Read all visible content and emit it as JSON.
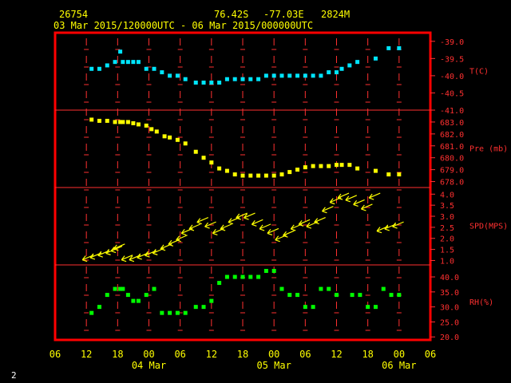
{
  "header": {
    "station": "26754",
    "lat": "76.42S",
    "lon": "-77.03E",
    "elev": "2824M",
    "range": "03 Mar 2015/120000UTC - 06 Mar 2015/000000UTC"
  },
  "footer": {
    "page": "2"
  },
  "colors": {
    "frame": "#ff0000",
    "grid": "#ff3030",
    "temp": "#00e5ff",
    "pres": "#ffff00",
    "wind": "#ffff00",
    "rh": "#00ff00",
    "text": "#ffff00"
  },
  "x_axis": {
    "start_hour": 6,
    "end_hour": 78,
    "tick_labels": [
      "06",
      "12",
      "18",
      "00",
      "06",
      "12",
      "18",
      "00",
      "06",
      "12",
      "18",
      "00",
      "06"
    ],
    "date_labels": [
      {
        "hour": 24,
        "text": "04 Mar"
      },
      {
        "hour": 48,
        "text": "05 Mar"
      },
      {
        "hour": 72,
        "text": "06 Mar"
      }
    ]
  },
  "chart_data": [
    {
      "type": "scatter",
      "unit_label": "T(C)",
      "ylim": [
        -41.0,
        -38.75
      ],
      "ticks": [
        "-39.0",
        "-39.5",
        "-40.0",
        "-40.5",
        "-41.0"
      ],
      "x": [
        13,
        14.5,
        16,
        17.5,
        18.5,
        19,
        20,
        21,
        22,
        23.5,
        25,
        26.5,
        28,
        29.5,
        31,
        33,
        34.5,
        36,
        37.5,
        39,
        40.5,
        42,
        43.5,
        45,
        46.5,
        48,
        49.5,
        51,
        52.5,
        54,
        55.5,
        57,
        58.5,
        60,
        61,
        62.5,
        64,
        67.5,
        70,
        72
      ],
      "values": [
        -39.8,
        -39.8,
        -39.7,
        -39.6,
        -39.3,
        -39.6,
        -39.6,
        -39.6,
        -39.6,
        -39.8,
        -39.8,
        -39.9,
        -40.0,
        -40.0,
        -40.1,
        -40.2,
        -40.2,
        -40.2,
        -40.2,
        -40.1,
        -40.1,
        -40.1,
        -40.1,
        -40.1,
        -40.0,
        -40.0,
        -40.0,
        -40.0,
        -40.0,
        -40.0,
        -40.0,
        -40.0,
        -39.9,
        -39.9,
        -39.8,
        -39.7,
        -39.6,
        -39.5,
        -39.2,
        -39.2
      ]
    },
    {
      "type": "scatter",
      "unit_label": "Pre (mb)",
      "ylim": [
        677.5,
        684.0
      ],
      "ticks": [
        "683.0",
        "682.0",
        "681.0",
        "680.0",
        "679.0",
        "678.0"
      ],
      "x": [
        13,
        14.5,
        16,
        17.5,
        18.5,
        19,
        20,
        21,
        22,
        23.5,
        24.5,
        25.5,
        27,
        28,
        29.5,
        31,
        33,
        34.5,
        36,
        37.5,
        39,
        40.5,
        42,
        43.5,
        45,
        46.5,
        48,
        49.5,
        51,
        52.5,
        54,
        55.5,
        57,
        58.5,
        60,
        61,
        62.5,
        64,
        67.5,
        70,
        72
      ],
      "values": [
        683.2,
        683.1,
        683.1,
        683.0,
        683.0,
        683.0,
        683.0,
        682.9,
        682.8,
        682.7,
        682.4,
        682.2,
        681.8,
        681.7,
        681.5,
        681.2,
        680.5,
        680.0,
        679.6,
        679.1,
        678.9,
        678.6,
        678.5,
        678.5,
        678.5,
        678.5,
        678.5,
        678.6,
        678.8,
        679.0,
        679.2,
        679.3,
        679.3,
        679.3,
        679.4,
        679.4,
        679.4,
        679.1,
        678.9,
        678.6,
        678.6
      ]
    },
    {
      "type": "scatter",
      "unit_label": "SPD(MPS)",
      "ylim": [
        0.8,
        4.3
      ],
      "ticks": [
        "4.0",
        "3.5",
        "3.0",
        "2.5",
        "2.0",
        "1.5",
        "1.0"
      ],
      "x": [
        12,
        13.5,
        15,
        16.5,
        17.5,
        18,
        19.5,
        21,
        22.5,
        24,
        25.5,
        27,
        28.5,
        30,
        31,
        32.5,
        34,
        35.5,
        37,
        38.5,
        40,
        41.5,
        43,
        44.5,
        46,
        47.5,
        49,
        50.5,
        52,
        53.5,
        55,
        56.5,
        58,
        59.5,
        61,
        62.5,
        64,
        65.5,
        67,
        68.5,
        70,
        71.5
      ],
      "values": [
        1.1,
        1.2,
        1.3,
        1.4,
        1.5,
        1.6,
        1.1,
        1.1,
        1.2,
        1.3,
        1.4,
        1.6,
        1.8,
        2.0,
        2.3,
        2.5,
        2.8,
        2.6,
        2.3,
        2.5,
        2.8,
        3.0,
        3.0,
        2.7,
        2.5,
        2.3,
        2.0,
        2.2,
        2.5,
        2.7,
        2.6,
        2.8,
        3.3,
        3.7,
        3.9,
        3.8,
        3.6,
        3.4,
        3.9,
        2.4,
        2.5,
        2.6
      ]
    },
    {
      "type": "scatter",
      "unit_label": "RH(%)",
      "ylim": [
        19.0,
        44.0
      ],
      "ticks": [
        "40.0",
        "35.0",
        "30.0",
        "25.0",
        "20.0"
      ],
      "x": [
        13,
        14.5,
        16,
        17.5,
        18.5,
        19,
        20,
        21,
        22,
        23.5,
        25,
        26.5,
        28,
        29.5,
        31,
        33,
        34.5,
        36,
        37.5,
        39,
        40.5,
        42,
        43.5,
        45,
        46.5,
        48,
        49.5,
        51,
        52.5,
        54,
        55.5,
        57,
        58.5,
        60,
        63,
        64.5,
        66,
        67.5,
        69,
        70.5,
        72
      ],
      "values": [
        28,
        30,
        34,
        36,
        36,
        36,
        34,
        32,
        32,
        34,
        36,
        28,
        28,
        28,
        28,
        30,
        30,
        32,
        38,
        40,
        40,
        40,
        40,
        40,
        42,
        42,
        36,
        34,
        34,
        30,
        30,
        36,
        36,
        34,
        34,
        34,
        30,
        30,
        36,
        34,
        34
      ]
    }
  ]
}
